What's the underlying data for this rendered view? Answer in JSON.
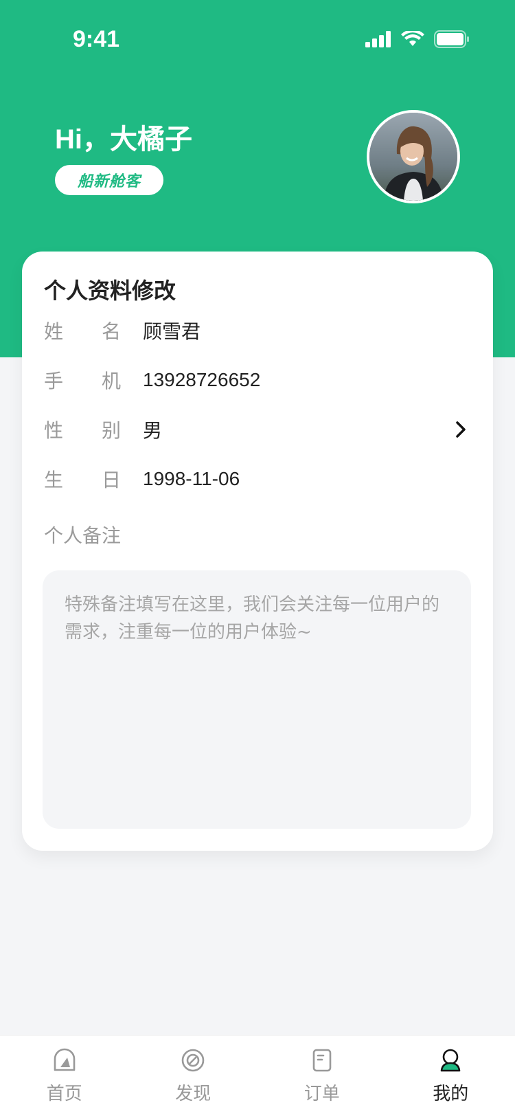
{
  "status_bar": {
    "time": "9:41"
  },
  "header": {
    "greeting": "Hi，大橘子",
    "member_tag": "船新舱客"
  },
  "profile_card": {
    "title": "个人资料修改",
    "fields": [
      {
        "label_a": "姓",
        "label_b": "名",
        "value": "顾雪君"
      },
      {
        "label_a": "手",
        "label_b": "机",
        "value": "13928726652"
      },
      {
        "label_a": "性",
        "label_b": "别",
        "value": "男"
      },
      {
        "label_a": "生",
        "label_b": "日",
        "value": "1998-11-06"
      }
    ],
    "note_label": "个人备注",
    "note_placeholder": "特殊备注填写在这里，我们会关注每一位用户的需求，注重每一位的用户体验~"
  },
  "tabbar": {
    "items": [
      {
        "label": "首页",
        "icon": "home-icon",
        "active": false
      },
      {
        "label": "发现",
        "icon": "discover-icon",
        "active": false
      },
      {
        "label": "订单",
        "icon": "order-icon",
        "active": false
      },
      {
        "label": "我的",
        "icon": "profile-icon",
        "active": true
      }
    ]
  },
  "colors": {
    "brand_green": "#1fba83",
    "page_bg": "#f4f5f7",
    "text_primary": "#222222",
    "text_secondary": "#9a9a9a"
  }
}
